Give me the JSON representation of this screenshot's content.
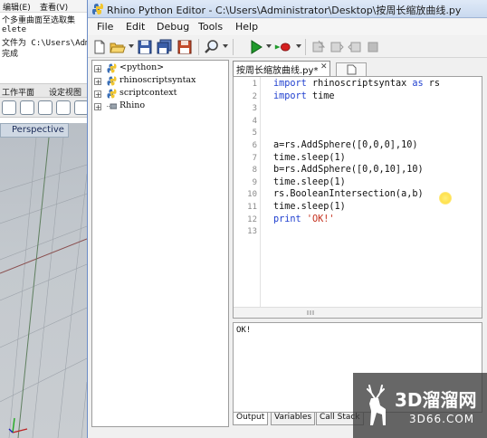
{
  "background_app": {
    "menu": [
      "编辑(E)",
      "查看(V)"
    ],
    "command_lines": [
      "个多重曲面至选取集",
      "elete",
      "文件为 C:\\Users\\Adm",
      "完成"
    ],
    "panel_tabs": [
      "工作平面",
      "设定视图"
    ],
    "viewport_label": "Perspective"
  },
  "editor": {
    "title": "Rhino Python Editor - C:\\Users\\Administrator\\Desktop\\按周长缩放曲线.py",
    "menu": {
      "file": "File",
      "edit": "Edit",
      "debug": "Debug",
      "tools": "Tools",
      "help": "Help"
    },
    "tree": [
      {
        "label": "<python>",
        "icon": "python-icon"
      },
      {
        "label": "rhinoscriptsyntax",
        "icon": "python-icon"
      },
      {
        "label": "scriptcontext",
        "icon": "python-icon"
      },
      {
        "label": "Rhino",
        "icon": "module-icon"
      }
    ],
    "tab_label": "按周长缩放曲线.py*",
    "code_lines": [
      {
        "n": "1",
        "html": "<span class='kw'>import</span> rhinoscriptsyntax <span class='kw'>as</span> rs"
      },
      {
        "n": "2",
        "html": "<span class='kw'>import</span> time"
      },
      {
        "n": "3",
        "html": ""
      },
      {
        "n": "4",
        "html": ""
      },
      {
        "n": "5",
        "html": ""
      },
      {
        "n": "6",
        "html": "a=rs.AddSphere([0,0,0],10)"
      },
      {
        "n": "7",
        "html": "time.sleep(1)"
      },
      {
        "n": "8",
        "html": "b=rs.AddSphere([0,0,10],10)"
      },
      {
        "n": "9",
        "html": "time.sleep(1)"
      },
      {
        "n": "10",
        "html": "rs.BooleanIntersection(a,b)"
      },
      {
        "n": "11",
        "html": "time.sleep(1)"
      },
      {
        "n": "12",
        "html": "<span class='kw'>print</span> <span class='str'>'OK!'</span>"
      },
      {
        "n": "13",
        "html": ""
      }
    ],
    "output_text": "OK!",
    "output_tabs": {
      "output": "Output",
      "variables": "Variables",
      "callstack": "Call Stack"
    }
  },
  "watermark": {
    "main": "3D溜溜网",
    "sub": "3D66.COM"
  },
  "colors": {
    "keyword": "#1f3fcf",
    "string": "#c42f1c",
    "run_green": "#1f9a2b",
    "stop_red": "#d42020"
  }
}
